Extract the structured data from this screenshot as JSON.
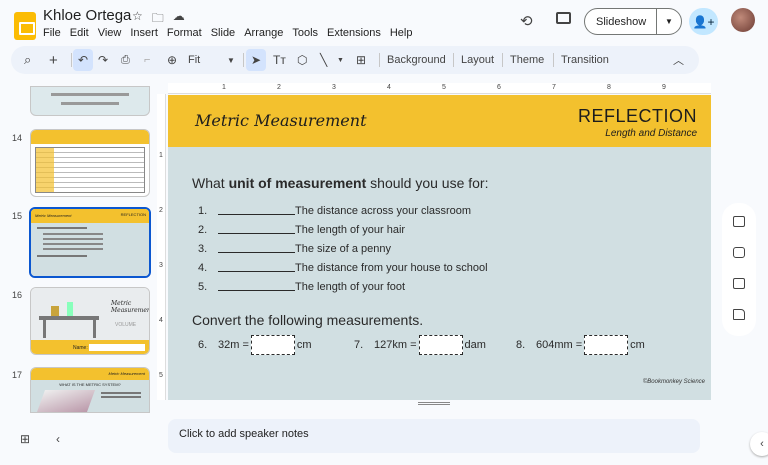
{
  "header": {
    "doc_title": "Khloe Ortega",
    "menu": [
      "File",
      "Edit",
      "View",
      "Insert",
      "Format",
      "Slide",
      "Arrange",
      "Tools",
      "Extensions",
      "Help"
    ],
    "slideshow_label": "Slideshow"
  },
  "toolbar": {
    "zoom": "Fit",
    "background": "Background",
    "layout": "Layout",
    "theme": "Theme",
    "transition": "Transition"
  },
  "sidebar": {
    "slides": [
      {
        "num": "14"
      },
      {
        "num": "15",
        "title": "Metric Measurement",
        "label": "REFLECTION"
      },
      {
        "num": "16",
        "title": "Metric Measurement",
        "word": "VOLUME",
        "name_label": "Name:"
      },
      {
        "num": "17",
        "title": "Metric Measurement",
        "heading": "WHAT IS THE METRIC SYSTEM?"
      }
    ]
  },
  "ruler": {
    "h_ticks": [
      "1",
      "2",
      "3",
      "4",
      "5",
      "6",
      "7",
      "8",
      "9"
    ],
    "v_ticks": [
      "1",
      "2",
      "3",
      "4",
      "5"
    ]
  },
  "slide": {
    "title": "Metric Measurement",
    "reflection": "REFLECTION",
    "subtitle": "Length and Distance",
    "question_pre": "What ",
    "question_bold": "unit of measurement",
    "question_post": " should you use for:",
    "items": [
      {
        "n": "1.",
        "text": "The distance across your classroom"
      },
      {
        "n": "2.",
        "text": "The length of your hair"
      },
      {
        "n": "3.",
        "text": "The size of a penny"
      },
      {
        "n": "4.",
        "text": "The distance from your house to school"
      },
      {
        "n": "5.",
        "text": "The length of your foot"
      }
    ],
    "convert_heading": "Convert the following measurements.",
    "conversions": [
      {
        "n": "6.",
        "from": "32m =",
        "unit": "cm"
      },
      {
        "n": "7.",
        "from": "127km =",
        "unit": "dam"
      },
      {
        "n": "8.",
        "from": "604mm =",
        "unit": "cm"
      }
    ],
    "credit": "©Bookmonkey Science"
  },
  "notes": {
    "placeholder": "Click to add speaker notes"
  },
  "colors": {
    "banner": "#f3c12e",
    "slide_bg": "#d1dfe2",
    "selection": "#0b57d0"
  }
}
